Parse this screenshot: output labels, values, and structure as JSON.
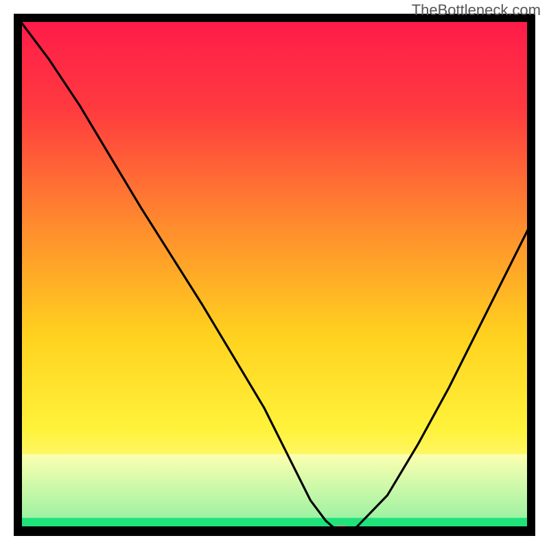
{
  "watermark": "TheBottleneck.com",
  "chart_data": {
    "type": "line",
    "title": "",
    "xlabel": "",
    "ylabel": "",
    "xlim": [
      0,
      100
    ],
    "ylim": [
      0,
      100
    ],
    "x": [
      0,
      6,
      12,
      18,
      24,
      30,
      36,
      42,
      48,
      54,
      57,
      60,
      62,
      64,
      66,
      72,
      78,
      84,
      90,
      96,
      100
    ],
    "values": [
      100,
      92,
      83,
      73,
      63,
      53.5,
      44,
      34,
      24,
      12,
      6,
      2,
      0.3,
      0.3,
      0.8,
      7,
      17,
      28,
      40,
      52,
      60
    ],
    "marker": {
      "x": 63,
      "y": 0.3
    },
    "green_band": {
      "y_top": 2.6,
      "y_bottom": 0
    },
    "fade_band": {
      "y_top": 15,
      "y_bottom": 2.6
    }
  }
}
